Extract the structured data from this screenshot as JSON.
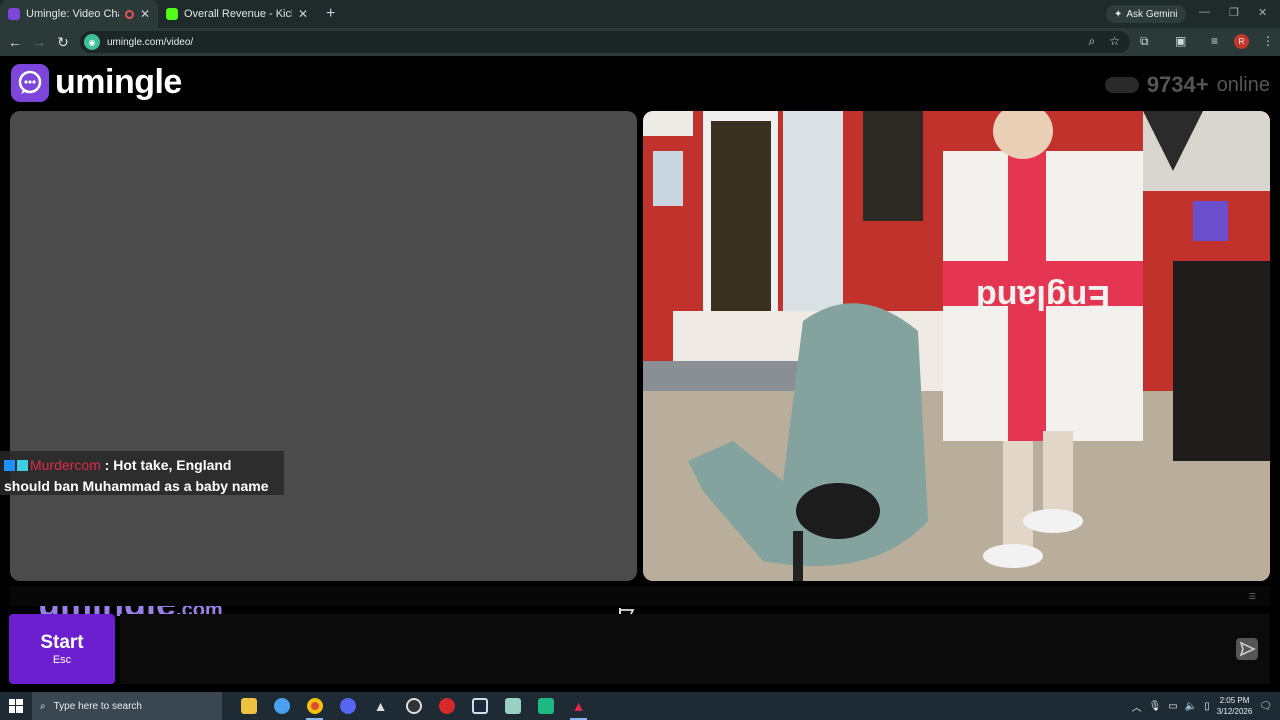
{
  "browser": {
    "tabs": [
      {
        "title": "Umingle: Video Chat with Strangers",
        "active": true,
        "favicon_color": "#7b46d9"
      },
      {
        "title": "Overall Revenue - Kick Dashboard",
        "active": false,
        "favicon_color": "#53fc18"
      }
    ],
    "new_tab": "+",
    "ask_gemini": "Ask Gemini",
    "url": "umingle.com/video/",
    "profile_initial": "R"
  },
  "site": {
    "logo_text": "umingle",
    "online_count": "9734+",
    "online_label": "online"
  },
  "chat": {
    "username": "Murdercom",
    "separator": " : ",
    "message": "Hot take, England should ban Muhammad as a baby name",
    "username_color": "#e0284a"
  },
  "watermark": {
    "main": "umingle",
    "suffix": ".com"
  },
  "controls": {
    "start_label": "Start",
    "start_shortcut": "Esc"
  },
  "taskbar": {
    "search_placeholder": "Type here to search",
    "time": "2:05 PM",
    "date": "3/12/2026"
  },
  "colors": {
    "accent": "#6b1fcf",
    "brand": "#7b46d9"
  }
}
